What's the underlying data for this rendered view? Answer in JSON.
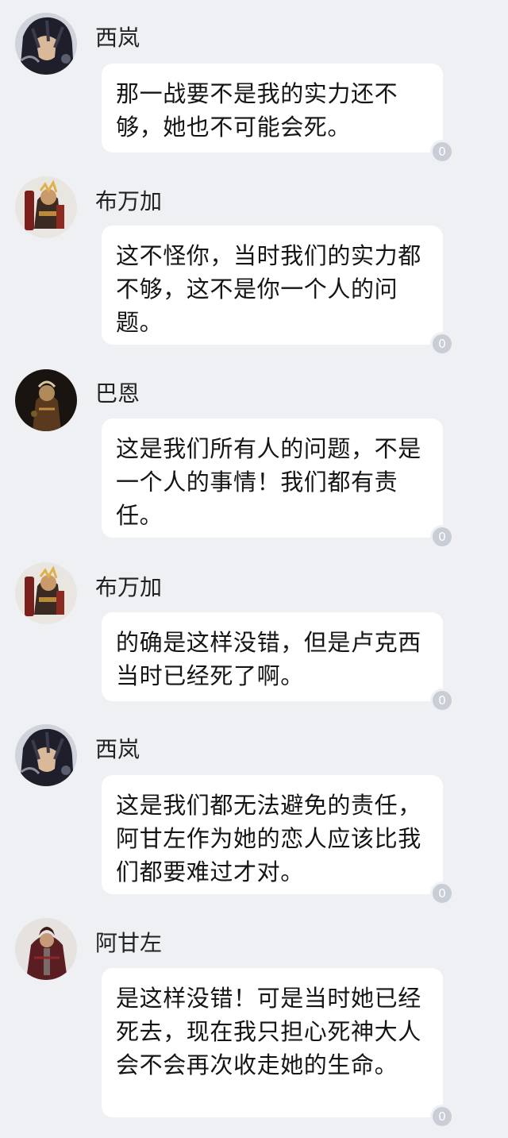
{
  "messages": [
    {
      "sender": "西岚",
      "avatar_icon": "xilan-avatar-icon",
      "text": "那一战要不是我的实力还不够，她也不可能会死。",
      "read_count": "0"
    },
    {
      "sender": "布万加",
      "avatar_icon": "buwanjia-avatar-icon",
      "text": "这不怪你，当时我们的实力都不够，这不是你一个人的问题。",
      "read_count": "0"
    },
    {
      "sender": "巴恩",
      "avatar_icon": "baen-avatar-icon",
      "text": "这是我们所有人的问题，不是一个人的事情！我们都有责任。",
      "read_count": "0"
    },
    {
      "sender": "布万加",
      "avatar_icon": "buwanjia-avatar-icon",
      "text": "的确是这样没错，但是卢克西当时已经死了啊。",
      "read_count": "0"
    },
    {
      "sender": "西岚",
      "avatar_icon": "xilan-avatar-icon",
      "text": "这是我们都无法避免的责任，阿甘左作为她的恋人应该比我们都要难过才对。",
      "read_count": "0"
    },
    {
      "sender": "阿甘左",
      "avatar_icon": "aganzuo-avatar-icon",
      "text": "是这样没错！可是当时她已经死去，现在我只担心死神大人会不会再次收走她的生命。",
      "read_count": "0"
    }
  ],
  "colors": {
    "background": "#eef0f4",
    "bubble": "#ffffff",
    "badge": "#c9ced6"
  }
}
